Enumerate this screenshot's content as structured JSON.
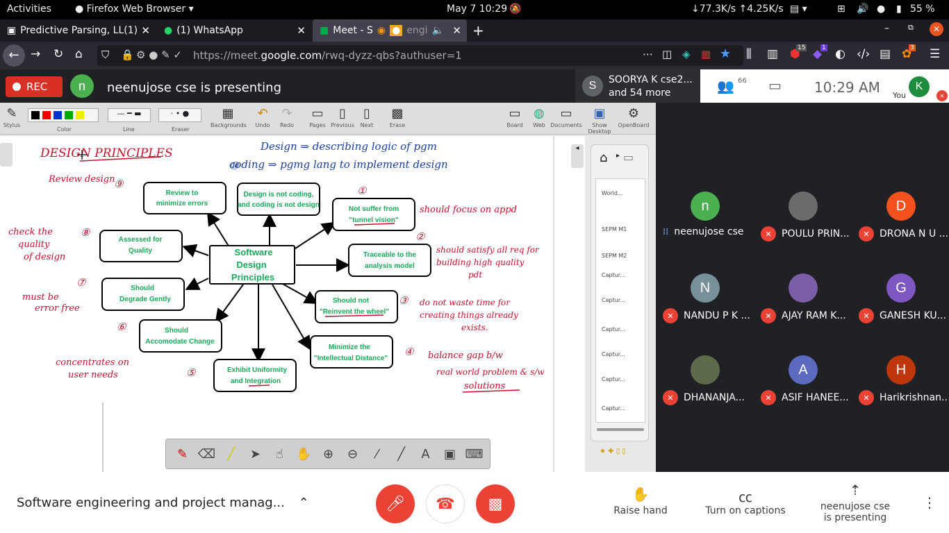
{
  "system_bar": {
    "activities": "Activities",
    "app": "Firefox Web Browser",
    "clock": "May 7  10:29",
    "net": "↓77.3K/s ↑4.25K/s",
    "battery": "55 %"
  },
  "tabs": [
    {
      "label": "Predictive Parsing, LL(1)"
    },
    {
      "label": "(1) WhatsApp"
    },
    {
      "label": "Meet - S"
    },
    {
      "label": "engi"
    }
  ],
  "browser": {
    "url_dim1": "https://meet.",
    "url_bold": "google.com",
    "url_dim2": "/rwq-dyzz-qbs?authuser=1",
    "badge1": "15",
    "badge2": "1",
    "badge3": "3"
  },
  "meet_header": {
    "rec": "REC",
    "presenter_initial": "n",
    "presenting_text": "neenujose cse is presenting",
    "join_initial": "S",
    "join_line1": "SOORYA K cse2...",
    "join_line2": "and 54 more",
    "people_count": "66",
    "time": "10:29  AM",
    "you_initial": "K",
    "you_label": "You"
  },
  "openboard": {
    "toolbar": [
      "Stylus",
      "Color",
      "Line",
      "Eraser",
      "Backgrounds",
      "Undo",
      "Redo",
      "Pages",
      "Previous",
      "Next",
      "Erase",
      "Board",
      "Web",
      "Documents",
      "Show Desktop",
      "OpenBoard"
    ],
    "library": [
      "World...",
      "SEPM M1",
      "SEPM M2",
      "Captur...",
      "Captur...",
      "Captur...",
      "Captur...",
      "Captur...",
      "Captur..."
    ]
  },
  "diagram": {
    "center": [
      "Software",
      "Design",
      "Principles"
    ],
    "nodes": {
      "review": [
        "Review to",
        "minimize errors"
      ],
      "notcoding": [
        "Design is not coding,",
        "and coding is not design"
      ],
      "tunnel": [
        "Not suffer from",
        "\"tunnel vision\""
      ],
      "quality": [
        "Assessed for",
        "Quality"
      ],
      "traceable": [
        "Traceable to the",
        "analysis model"
      ],
      "degrade": [
        "Should",
        "Degrade Gently"
      ],
      "wheel": [
        "Should not",
        "\"Reinvent the wheel\""
      ],
      "change": [
        "Should",
        "Accomodate Change"
      ],
      "intellect": [
        "Minimize the",
        "\"Intellectual Distance\""
      ],
      "uniform": [
        "Exhibit Uniformity",
        "and Integration"
      ]
    },
    "handwriting": {
      "title": "DESIGN  PRINCIPLES",
      "def1": "Design ⇒ describing logic of pgm",
      "def2": "coding ⇒ pgmg lang to implement design",
      "review_design": "Review design",
      "check_quality": [
        "check the",
        "quality",
        "of design"
      ],
      "must_be": [
        "must be",
        "error free"
      ],
      "concentrate": [
        "concentrates on",
        "user needs"
      ],
      "focus": "should focus on appd",
      "satisfy": [
        "should satisfy all req for",
        "building high quality",
        "pdt"
      ],
      "dont_waste": [
        "do not waste time for",
        "creating things already",
        "exists."
      ],
      "balance": [
        "balance gap b/w",
        "real world problem & s/w",
        "solutions"
      ],
      "nums": [
        "①",
        "②",
        "③",
        "④",
        "⑤",
        "⑥",
        "⑦",
        "⑧",
        "⑨",
        "⑩"
      ]
    }
  },
  "participants": [
    {
      "initial": "n",
      "name": "neenujose cse",
      "color": "#4caf50",
      "muted": false
    },
    {
      "initial": "",
      "name": "POULU PRIN...",
      "color": "#6b6b6b",
      "muted": true
    },
    {
      "initial": "D",
      "name": "DRONA N U ...",
      "color": "#f4511e",
      "muted": true
    },
    {
      "initial": "N",
      "name": "NANDU P K ...",
      "color": "#78909c",
      "muted": true
    },
    {
      "initial": "",
      "name": "AJAY RAM K...",
      "color": "#7b5ea7",
      "muted": true
    },
    {
      "initial": "G",
      "name": "GANESH KU...",
      "color": "#7e57c2",
      "muted": true
    },
    {
      "initial": "",
      "name": "DHANANJA...",
      "color": "#5d6b4a",
      "muted": true
    },
    {
      "initial": "A",
      "name": "ASIF HANEE...",
      "color": "#5c6bc0",
      "muted": true
    },
    {
      "initial": "H",
      "name": "Harikrishnan...",
      "color": "#bf360c",
      "muted": true
    }
  ],
  "bottom": {
    "meeting_title": "Software engineering and project manag...",
    "raise_hand": "Raise hand",
    "captions": "Turn on captions",
    "present1": "neenujose cse",
    "present2": "is presenting"
  },
  "colors": {
    "meet_dark": "#202124",
    "danger": "#ea4335",
    "diagram_green": "#1aa85a"
  }
}
